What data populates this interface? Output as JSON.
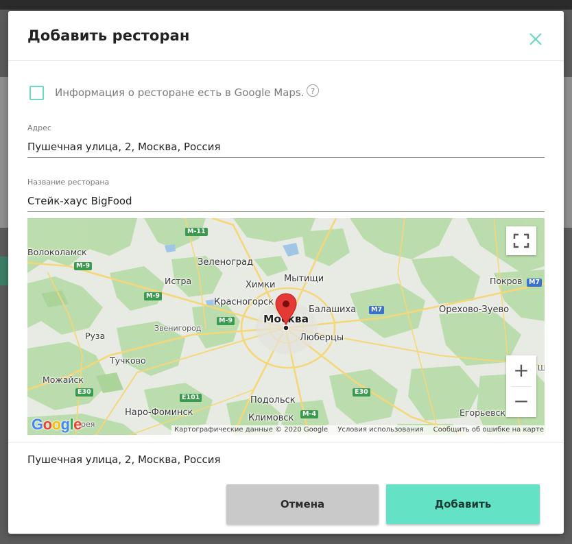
{
  "modal": {
    "title": "Добавить ресторан",
    "google_maps_checkbox_label": "Информация о ресторане есть в Google Maps.",
    "google_maps_checked": false,
    "help_symbol": "?",
    "address": {
      "label": "Адрес",
      "value": "Пушечная улица, 2, Москва, Россия"
    },
    "restaurant_name": {
      "label": "Название ресторана",
      "value": "Стейк-хаус BigFood"
    },
    "selected_address": "Пушечная улица, 2, Москва, Россия",
    "cancel_label": "Отмена",
    "add_label": "Добавить"
  },
  "map": {
    "labels": {
      "moscow": "Москва",
      "volokolamsk": "Волоколамск",
      "zelenograd": "Зеленоград",
      "istra": "Истра",
      "khimki": "Химки",
      "mytishchi": "Мытищи",
      "pokrov": "Покров",
      "krasnogorsk": "Красногорск",
      "balashikha": "Балашиха",
      "orekhovo": "Орехово-Зуево",
      "zvenigorod": "Звенигород",
      "ruza": "Руза",
      "lyubertsy": "Люберцы",
      "tuchkovo": "Тучково",
      "mozhaysk": "Можайск",
      "podolsk": "Подольск",
      "naro": "Наро-Фоминск",
      "klimovsk": "Климовск",
      "egoryevsk": "Егорьевск",
      "vereya": "рея",
      "sh": "Ш"
    },
    "roads": {
      "m11": "M-11",
      "m9a": "M-9",
      "m9b": "M-9",
      "m9c": "M-9",
      "m7a": "M7",
      "m7b": "M7",
      "e30a": "E30",
      "e30b": "E30",
      "e101": "E101",
      "m4": "M-4"
    },
    "attribution": {
      "data": "Картографические данные © 2020 Google",
      "terms": "Условия использования",
      "report": "Сообщить об ошибке на карте"
    },
    "logo": "Google",
    "controls": {
      "zoom_in": "+",
      "zoom_out": "−"
    },
    "colors": {
      "park": "#b9dcaa",
      "road": "#f5d77a",
      "pin": "#e53935"
    }
  }
}
